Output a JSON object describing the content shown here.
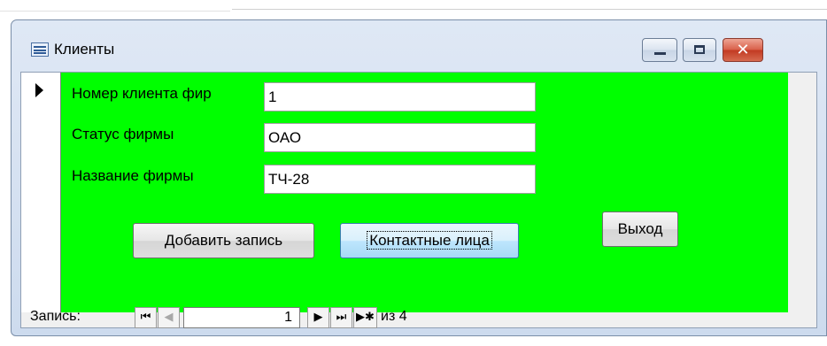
{
  "window": {
    "title": "Клиенты",
    "close_glyph": "✕"
  },
  "form": {
    "fields": [
      {
        "label": "Номер клиента фир",
        "value": "1"
      },
      {
        "label": "Статус фирмы",
        "value": "ОАО"
      },
      {
        "label": "Название фирмы",
        "value": "ТЧ-28"
      }
    ],
    "buttons": {
      "add_record": "Добавить запись",
      "contacts": "Контактные лица",
      "exit": "Выход"
    },
    "background_color": "#00ff00"
  },
  "navigation": {
    "label": "Запись:",
    "first_glyph": "⏮",
    "prev_glyph": "◀",
    "current_record": "1",
    "next_glyph": "▶",
    "last_glyph": "⏭",
    "new_glyph": "▶✱",
    "total_text": "из  4"
  }
}
